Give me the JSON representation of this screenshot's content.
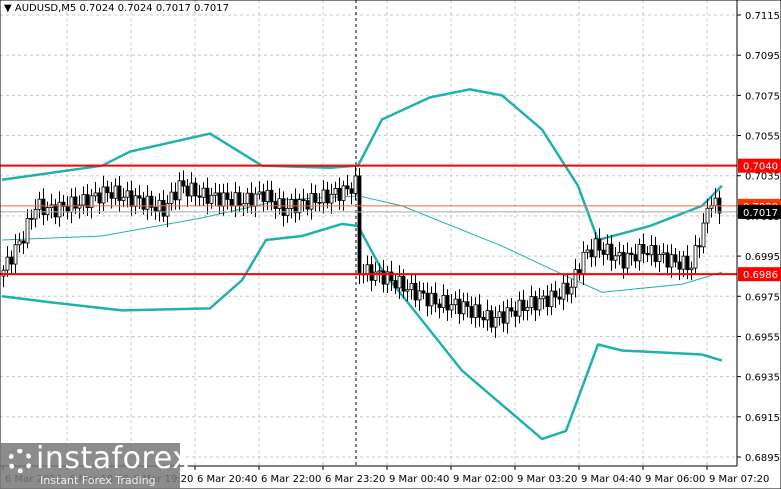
{
  "header": {
    "arrow": "▼",
    "symbol": "AUDUSD,M5",
    "ohlc": "0.7024 0.7024 0.7017 0.7017"
  },
  "chart_data": {
    "type": "candlestick",
    "title": "AUDUSD,M5",
    "ylim": [
      0.6895,
      0.7115
    ],
    "y_ticks": [
      "0.7115",
      "0.7095",
      "0.7075",
      "0.7055",
      "0.7035",
      "0.7015",
      "0.6995",
      "0.6975",
      "0.6955",
      "0.6935",
      "0.6915",
      "0.6895"
    ],
    "x_ticks": [
      "6 Mar 2026",
      "6 Mar 18:00",
      "6 Mar 19:20",
      "6 Mar 20:40",
      "6 Mar 22:00",
      "6 Mar 23:20",
      "9 Mar 00:40",
      "9 Mar 02:00",
      "9 Mar 03:20",
      "9 Mar 04:40",
      "9 Mar 06:00",
      "9 Mar 07:20"
    ],
    "bars_per_tick": 16,
    "bar_count": 180,
    "period_separator_bar": 89,
    "close_path": [
      [
        0,
        0.6988
      ],
      [
        2,
        0.6995
      ],
      [
        5,
        0.7005
      ],
      [
        8,
        0.702
      ],
      [
        12,
        0.7018
      ],
      [
        20,
        0.7022
      ],
      [
        26,
        0.7027
      ],
      [
        35,
        0.7022
      ],
      [
        40,
        0.7018
      ],
      [
        44,
        0.703
      ],
      [
        50,
        0.7025
      ],
      [
        60,
        0.7022
      ],
      [
        65,
        0.7026
      ],
      [
        70,
        0.7018
      ],
      [
        72,
        0.702
      ],
      [
        80,
        0.7024
      ],
      [
        86,
        0.7028
      ],
      [
        88,
        0.7031
      ],
      [
        89,
        0.6988
      ],
      [
        95,
        0.6985
      ],
      [
        100,
        0.698
      ],
      [
        108,
        0.6972
      ],
      [
        115,
        0.697
      ],
      [
        122,
        0.6963
      ],
      [
        130,
        0.697
      ],
      [
        138,
        0.6975
      ],
      [
        142,
        0.698
      ],
      [
        145,
        0.6995
      ],
      [
        148,
        0.7
      ],
      [
        155,
        0.6993
      ],
      [
        160,
        0.6998
      ],
      [
        168,
        0.6992
      ],
      [
        172,
        0.699
      ],
      [
        175,
        0.701
      ],
      [
        177,
        0.7024
      ],
      [
        179,
        0.7017
      ]
    ],
    "bollinger": {
      "upper": [
        [
          0,
          0.7033
        ],
        [
          25,
          0.704
        ],
        [
          32,
          0.7047
        ],
        [
          52,
          0.7056
        ],
        [
          65,
          0.704
        ],
        [
          82,
          0.7039
        ],
        [
          89,
          0.704
        ],
        [
          95,
          0.7063
        ],
        [
          107,
          0.7074
        ],
        [
          117,
          0.7078
        ],
        [
          125,
          0.7075
        ],
        [
          135,
          0.7058
        ],
        [
          144,
          0.703
        ],
        [
          149,
          0.7003
        ],
        [
          162,
          0.701
        ],
        [
          175,
          0.702
        ],
        [
          180,
          0.703
        ]
      ],
      "middle": [
        [
          0,
          0.7003
        ],
        [
          25,
          0.7005
        ],
        [
          50,
          0.7014
        ],
        [
          70,
          0.7023
        ],
        [
          89,
          0.7025
        ],
        [
          100,
          0.702
        ],
        [
          125,
          0.7
        ],
        [
          140,
          0.6986
        ],
        [
          150,
          0.6977
        ],
        [
          170,
          0.6981
        ],
        [
          180,
          0.6987
        ]
      ],
      "lower": [
        [
          0,
          0.6975
        ],
        [
          12,
          0.6972
        ],
        [
          30,
          0.6968
        ],
        [
          52,
          0.6969
        ],
        [
          60,
          0.6983
        ],
        [
          66,
          0.7003
        ],
        [
          75,
          0.7005
        ],
        [
          85,
          0.7011
        ],
        [
          89,
          0.701
        ],
        [
          95,
          0.6988
        ],
        [
          105,
          0.6963
        ],
        [
          115,
          0.6938
        ],
        [
          125,
          0.6921
        ],
        [
          135,
          0.6904
        ],
        [
          141,
          0.6908
        ],
        [
          149,
          0.6951
        ],
        [
          155,
          0.6948
        ],
        [
          165,
          0.6947
        ],
        [
          175,
          0.6946
        ],
        [
          180,
          0.6943
        ]
      ]
    },
    "levels": [
      {
        "price": "0.7040",
        "color": "#ff0000"
      },
      {
        "price": "0.6986",
        "color": "#ff0000"
      }
    ],
    "price_labels": [
      {
        "price": "0.7020",
        "color": "#ff3300"
      },
      {
        "price": "0.7017",
        "color": "#000000"
      }
    ]
  },
  "logo": {
    "name": "instaforex",
    "tagline": "Instant Forex Trading"
  },
  "colors": {
    "band": "#20b2aa",
    "level": "#ff0000"
  }
}
